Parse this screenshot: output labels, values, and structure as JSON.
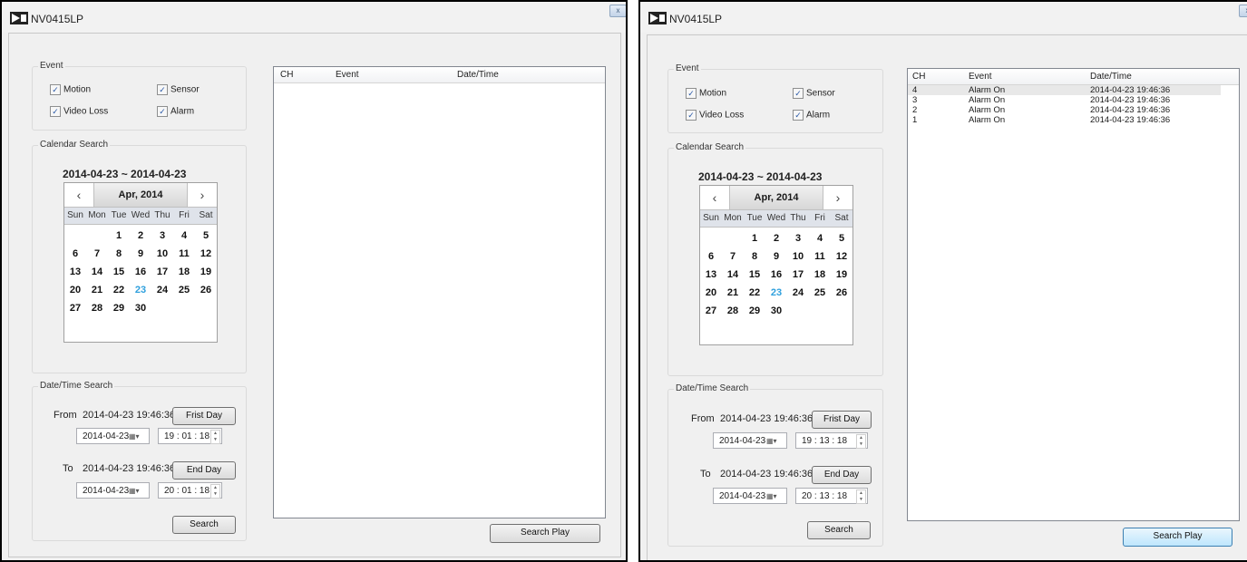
{
  "left_window": {
    "title": "NV0415LP",
    "close_label": "x",
    "event": {
      "legend": "Event",
      "motion": "Motion",
      "sensor": "Sensor",
      "video_loss": "Video Loss",
      "alarm": "Alarm",
      "checked": [
        true,
        true,
        true,
        true
      ]
    },
    "calendar_search": {
      "legend": "Calendar Search",
      "range": "2014-04-23 ~ 2014-04-23",
      "month": "Apr, 2014",
      "prev": "‹",
      "next": "›",
      "weekdays": [
        "Sun",
        "Mon",
        "Tue",
        "Wed",
        "Thu",
        "Fri",
        "Sat"
      ],
      "weeks": [
        [
          "",
          "",
          "1",
          "2",
          "3",
          "4",
          "5"
        ],
        [
          "6",
          "7",
          "8",
          "9",
          "10",
          "11",
          "12"
        ],
        [
          "13",
          "14",
          "15",
          "16",
          "17",
          "18",
          "19"
        ],
        [
          "20",
          "21",
          "22",
          "23",
          "24",
          "25",
          "26"
        ],
        [
          "27",
          "28",
          "29",
          "30",
          "",
          "",
          ""
        ]
      ],
      "selected_day": "23"
    },
    "datetime_search": {
      "legend": "Date/Time Search",
      "from_label": "From",
      "from_value": "2014-04-23 19:46:36",
      "first_day_button": "Frist Day",
      "from_date": "2014-04-23",
      "from_time": "19 : 01 : 18",
      "to_label": "To",
      "to_value": "2014-04-23 19:46:36",
      "end_day_button": "End Day",
      "to_date": "2014-04-23",
      "to_time": "20 : 01 : 18",
      "search_button": "Search"
    },
    "results": {
      "columns": [
        "CH",
        "Event",
        "Date/Time"
      ],
      "rows": []
    },
    "search_play_button": "Search Play"
  },
  "right_window": {
    "title": "NV0415LP",
    "close_label": "x",
    "event": {
      "legend": "Event",
      "motion": "Motion",
      "sensor": "Sensor",
      "video_loss": "Video Loss",
      "alarm": "Alarm",
      "checked": [
        true,
        true,
        true,
        true
      ]
    },
    "calendar_search": {
      "legend": "Calendar Search",
      "range": "2014-04-23 ~ 2014-04-23",
      "month": "Apr, 2014",
      "prev": "‹",
      "next": "›",
      "weekdays": [
        "Sun",
        "Mon",
        "Tue",
        "Wed",
        "Thu",
        "Fri",
        "Sat"
      ],
      "weeks": [
        [
          "",
          "",
          "1",
          "2",
          "3",
          "4",
          "5"
        ],
        [
          "6",
          "7",
          "8",
          "9",
          "10",
          "11",
          "12"
        ],
        [
          "13",
          "14",
          "15",
          "16",
          "17",
          "18",
          "19"
        ],
        [
          "20",
          "21",
          "22",
          "23",
          "24",
          "25",
          "26"
        ],
        [
          "27",
          "28",
          "29",
          "30",
          "",
          "",
          ""
        ]
      ],
      "selected_day": "23"
    },
    "datetime_search": {
      "legend": "Date/Time Search",
      "from_label": "From",
      "from_value": "2014-04-23 19:46:36",
      "first_day_button": "Frist Day",
      "from_date": "2014-04-23",
      "from_time": "19 : 13 : 18",
      "to_label": "To",
      "to_value": "2014-04-23 19:46:36",
      "end_day_button": "End Day",
      "to_date": "2014-04-23",
      "to_time": "20 : 13 : 18",
      "search_button": "Search"
    },
    "results": {
      "columns": [
        "CH",
        "Event",
        "Date/Time"
      ],
      "rows": [
        {
          "ch": "4",
          "event": "Alarm On",
          "datetime": "2014-04-23 19:46:36",
          "selected": true
        },
        {
          "ch": "3",
          "event": "Alarm On",
          "datetime": "2014-04-23 19:46:36",
          "selected": false
        },
        {
          "ch": "2",
          "event": "Alarm On",
          "datetime": "2014-04-23 19:46:36",
          "selected": false
        },
        {
          "ch": "1",
          "event": "Alarm On",
          "datetime": "2014-04-23 19:46:36",
          "selected": false
        }
      ]
    },
    "search_play_button": "Search Play"
  }
}
